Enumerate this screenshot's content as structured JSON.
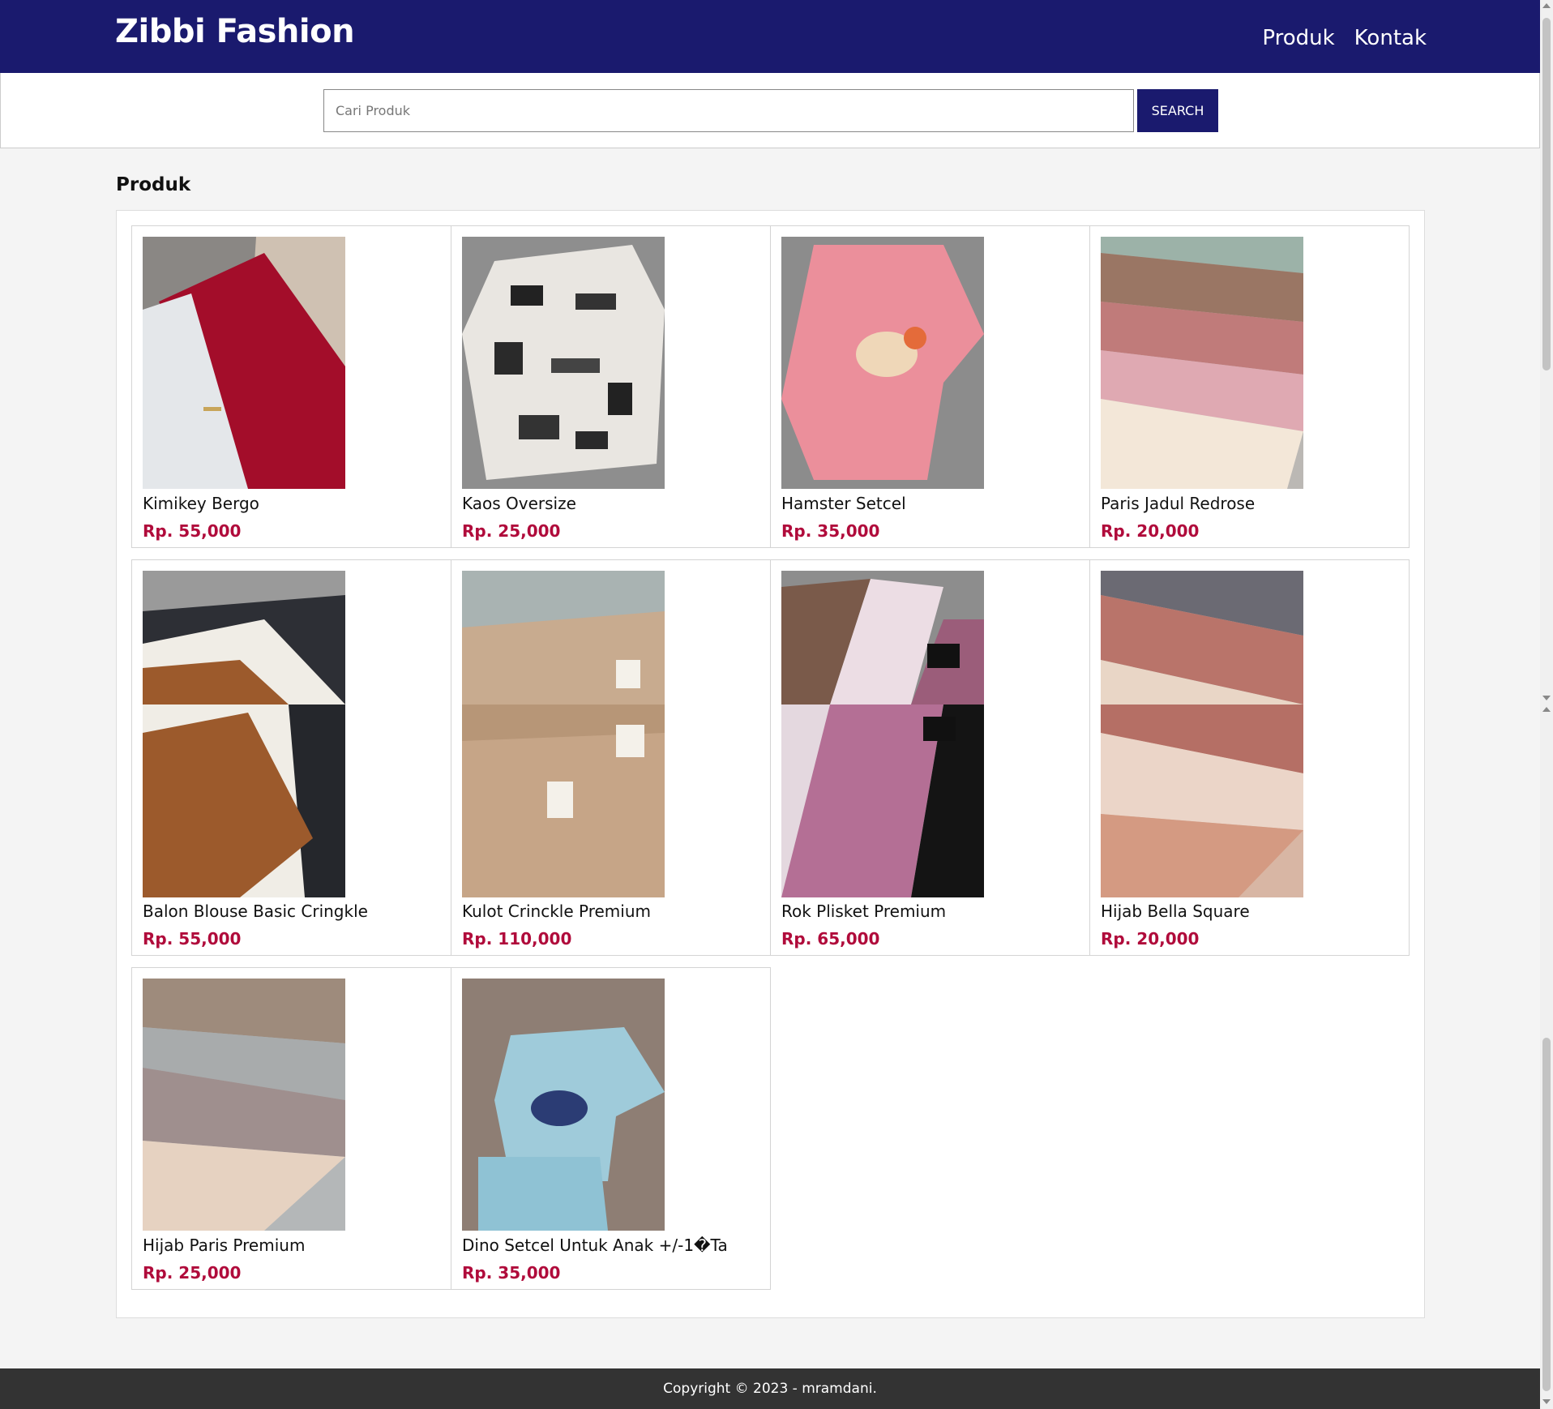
{
  "header": {
    "brand": "Zibbi Fashion",
    "nav": [
      "Produk",
      "Kontak"
    ]
  },
  "search": {
    "placeholder": "Cari Produk",
    "button_label": "SEARCH"
  },
  "products_section": {
    "title": "Produk",
    "items": [
      {
        "name": "Kimikey Bergo",
        "price": "Rp. 55,000"
      },
      {
        "name": "Kaos Oversize",
        "price": "Rp. 25,000"
      },
      {
        "name": "Hamster Setcel",
        "price": "Rp. 35,000"
      },
      {
        "name": "Paris Jadul Redrose",
        "price": "Rp. 20,000"
      },
      {
        "name": "Balon Blouse Basic Cringkle",
        "price": "Rp. 55,000"
      },
      {
        "name": "Kulot Crinckle Premium",
        "price": "Rp. 110,000"
      },
      {
        "name": "Rok Plisket Premium",
        "price": "Rp. 65,000"
      },
      {
        "name": "Hijab Bella Square",
        "price": "Rp. 20,000"
      },
      {
        "name": "Hijab Paris Premium",
        "price": "Rp. 25,000"
      },
      {
        "name": "Dino Setcel Untuk Anak +/-1�Ta",
        "price": "Rp. 35,000"
      }
    ]
  },
  "footer": {
    "text": "Copyright © 2023 - mramdani."
  },
  "colors": {
    "header_bg": "#1a1a6e",
    "price": "#b00b3b",
    "footer_bg": "#333333"
  }
}
